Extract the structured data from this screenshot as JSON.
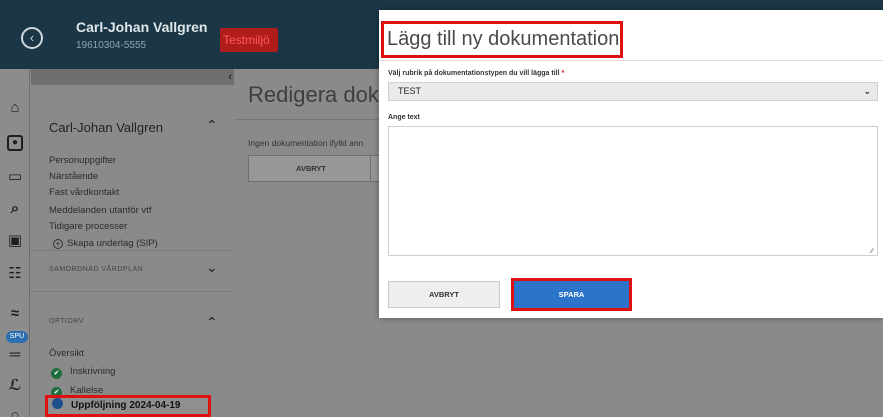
{
  "header": {
    "back_icon": "chevron-left-icon",
    "patient_name": "Carl-Johan Vallgren",
    "patient_id": "19610304-5555",
    "environment_badge": "Testmiljö",
    "environment_color": "#b01c1c"
  },
  "rail": {
    "icons": [
      "home-icon",
      "patient-icon",
      "inbox-icon",
      "search-icon",
      "document-icon",
      "team-icon",
      "chart-icon",
      "bed-icon",
      "link-icon"
    ],
    "spu_badge": "SPU"
  },
  "sidebar": {
    "heading": "Carl-Johan Vallgren",
    "links": [
      "Personuppgifter",
      "Närstående",
      "Fast vårdkontakt",
      "Meddelanden utanför vtf",
      "Tidigare processer"
    ],
    "create_basis": "Skapa underlag (SIP)",
    "section_plan": "SAMORDNAD VÅRDPLAN",
    "section_followup": "OPTIORV",
    "overview": "Översikt",
    "steps": [
      "Inskrivning",
      "Kallelse"
    ],
    "active_step": "Uppföljning 2024-04-19"
  },
  "main": {
    "title": "Redigera dokum",
    "info": "Ingen dokumentation ifylld ann",
    "cancel_label": "AVBRYT"
  },
  "modal": {
    "title": "Lägg till ny dokumentation",
    "select_label": "Välj rubrik på dokumentationstypen du vill lägga till",
    "required_marker": "*",
    "select_value": "TEST",
    "text_label": "Ange text",
    "text_value": "",
    "cancel_label": "AVBRYT",
    "save_label": "SPARA",
    "accent_color": "#2c74c9",
    "highlight_color": "#e01010"
  }
}
